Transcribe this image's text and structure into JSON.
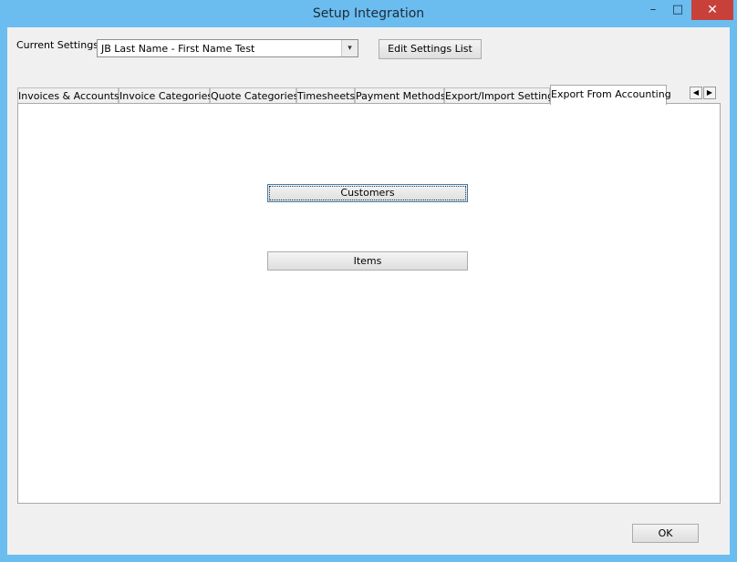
{
  "window": {
    "title": "Setup Integration",
    "controls": {
      "minimize": "–",
      "maximize": "□",
      "close": "✕"
    }
  },
  "settings": {
    "label": "Current Settings",
    "selected_value": "JB Last Name - First Name Test",
    "dropdown_arrow": "▾",
    "edit_button": "Edit Settings List"
  },
  "tabs": [
    {
      "label": "Invoices & Accounts"
    },
    {
      "label": "Invoice Categories"
    },
    {
      "label": "Quote Categories"
    },
    {
      "label": "Timesheets"
    },
    {
      "label": "Payment Methods"
    },
    {
      "label": "Export/Import Settings"
    },
    {
      "label": "Export From Accounting",
      "active": true
    }
  ],
  "tab_scroll": {
    "left": "◀",
    "right": "▶"
  },
  "panel": {
    "customers_button": "Customers",
    "items_button": "Items"
  },
  "footer": {
    "ok_button": "OK"
  },
  "colors": {
    "title_bar": "#6bbdf0",
    "close_button": "#c7413a",
    "client_bg": "#f0f0f0"
  }
}
